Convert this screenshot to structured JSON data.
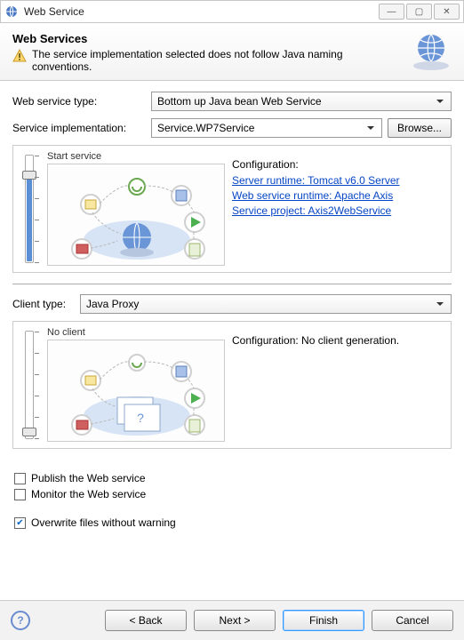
{
  "titlebar": {
    "title": "Web Service"
  },
  "header": {
    "heading": "Web Services",
    "warning": "The service implementation selected does not follow Java naming conventions."
  },
  "form": {
    "ws_type_label": "Web service type:",
    "ws_type_value": "Bottom up Java bean Web Service",
    "svc_impl_label": "Service implementation:",
    "svc_impl_value": "Service.WP7Service",
    "browse_label": "Browse..."
  },
  "service_panel": {
    "slider_label": "Start service",
    "config_title": "Configuration:",
    "links": {
      "server": "Server runtime: Tomcat v6.0 Server",
      "runtime": "Web service runtime: Apache Axis",
      "project": "Service project: Axis2WebService"
    }
  },
  "client": {
    "label": "Client type:",
    "value": "Java Proxy",
    "slider_label": "No client",
    "config_text": "Configuration: No client generation."
  },
  "checks": {
    "publish": "Publish the Web service",
    "monitor": "Monitor the Web service",
    "overwrite": "Overwrite files without warning"
  },
  "footer": {
    "back": "< Back",
    "next": "Next >",
    "finish": "Finish",
    "cancel": "Cancel"
  }
}
